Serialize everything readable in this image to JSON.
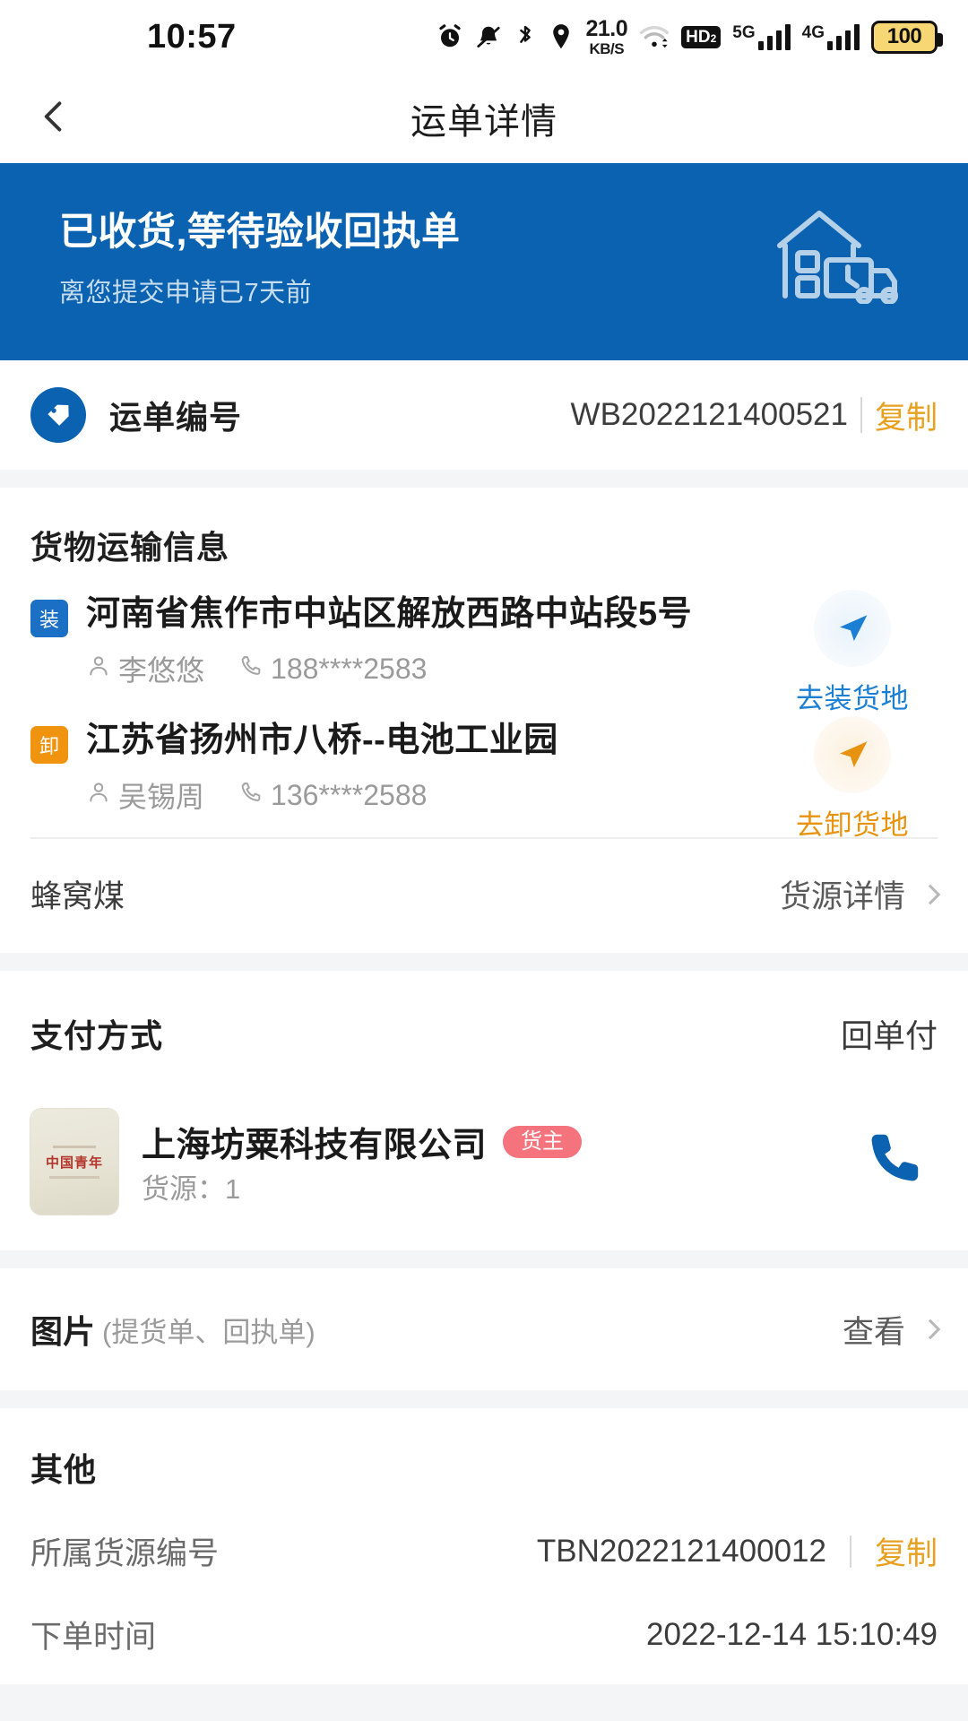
{
  "status_bar": {
    "time": "10:57",
    "net_speed_value": "21.0",
    "net_speed_unit": "KB/S",
    "hd_label": "HD",
    "hd_sub": "2",
    "signal_5g": "5G",
    "signal_4g": "4G",
    "battery": "100",
    "icons": [
      "alarm-icon",
      "bell-muted-icon",
      "bluetooth-icon",
      "location-icon",
      "wifi-icon",
      "hd-icon",
      "signal-5g-icon",
      "signal-4g-icon",
      "battery-icon"
    ]
  },
  "nav": {
    "back_icon": "chevron-left-icon",
    "title": "运单详情"
  },
  "hero": {
    "title": "已收货,等待验收回执单",
    "subtitle": "离您提交申请已7天前",
    "art_icon": "warehouse-truck-icon",
    "bg_color": "#0a62b0"
  },
  "waybill": {
    "icon": "tag-icon",
    "label": "运单编号",
    "number": "WB2022121400521",
    "copy_label": "复制",
    "copy_color": "#e8a020"
  },
  "shipping": {
    "section_title": "货物运输信息",
    "stops": [
      {
        "badge": "装",
        "badge_color": "#1b6fc4",
        "address": "河南省焦作市中站区解放西路中站段5号",
        "contact_name": "李悠悠",
        "contact_phone": "188****2583",
        "action_label": "去装货地",
        "action_color": "#1b7fd4",
        "action_icon": "navigation-arrow-icon"
      },
      {
        "badge": "卸",
        "badge_color": "#f0930f",
        "address": "江苏省扬州市八桥--电池工业园",
        "contact_name": "吴锡周",
        "contact_phone": "136****2588",
        "action_label": "去卸货地",
        "action_color": "#e8930f",
        "action_icon": "navigation-arrow-icon"
      }
    ],
    "cargo_name": "蜂窝煤",
    "cargo_detail_label": "货源详情"
  },
  "payment": {
    "label": "支付方式",
    "value": "回单付"
  },
  "owner": {
    "thumb_text": "中国青年",
    "name": "上海坊粟科技有限公司",
    "badge": "货主",
    "badge_color": "#f4737c",
    "source_label": "货源：1",
    "call_icon": "phone-icon",
    "call_icon_color": "#0a62b0"
  },
  "pictures": {
    "label": "图片",
    "note": "(提货单、回执单)",
    "action_label": "查看"
  },
  "other": {
    "section_title": "其他",
    "rows": [
      {
        "key": "所属货源编号",
        "value": "TBN2022121400012",
        "copy_label": "复制"
      },
      {
        "key": "下单时间",
        "value": "2022-12-14 15:10:49",
        "copy_label": ""
      }
    ]
  }
}
